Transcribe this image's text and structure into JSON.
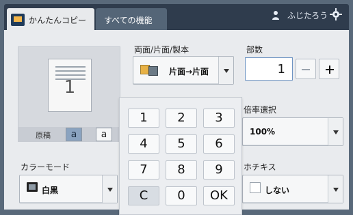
{
  "header": {
    "tabs": [
      {
        "label": "かんたんコピー"
      },
      {
        "label": "すべての機能"
      }
    ],
    "user_name": "ふじたろう"
  },
  "duplex": {
    "label": "両面/片面/製本",
    "value": "片面→片面"
  },
  "copies": {
    "label": "部数",
    "value": "1",
    "minus": "−",
    "plus": "+"
  },
  "original": {
    "page_number": "1",
    "label": "原稿",
    "sizes": [
      {
        "label": "a"
      },
      {
        "label": "a"
      }
    ]
  },
  "ratio": {
    "label": "倍率選択",
    "value": "100%"
  },
  "color_mode": {
    "label": "カラーモード",
    "value": "白黒"
  },
  "staple": {
    "label": "ホチキス",
    "value": "しない"
  },
  "keypad": {
    "keys": [
      "1",
      "2",
      "3",
      "4",
      "5",
      "6",
      "7",
      "8",
      "9",
      "C",
      "0",
      "OK"
    ]
  }
}
